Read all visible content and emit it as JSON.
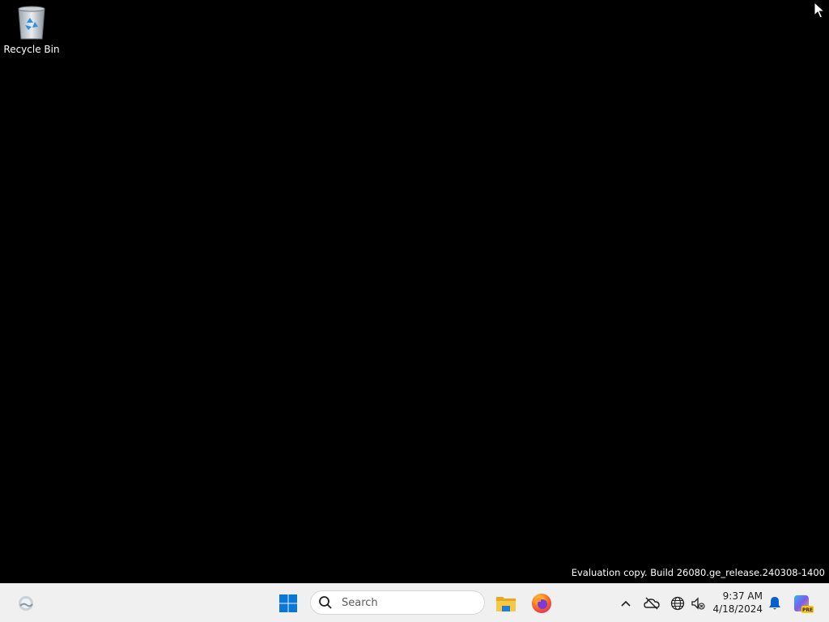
{
  "desktop": {
    "icons": [
      {
        "label": "Recycle Bin",
        "icon": "recycle-bin-icon"
      }
    ],
    "watermark": "Evaluation copy. Build 26080.ge_release.240308-1400"
  },
  "taskbar": {
    "search": {
      "placeholder": "Search"
    },
    "pinned": [
      {
        "name": "File Explorer",
        "icon": "folder-icon"
      },
      {
        "name": "Firefox",
        "icon": "firefox-icon"
      }
    ],
    "tray": {
      "time": "9:37 AM",
      "date": "4/18/2024"
    },
    "colors": {
      "taskbar_bg": "#f0f0f0",
      "start_blue": "#0a78d7",
      "notification_blue": "#0a5fc9"
    }
  }
}
